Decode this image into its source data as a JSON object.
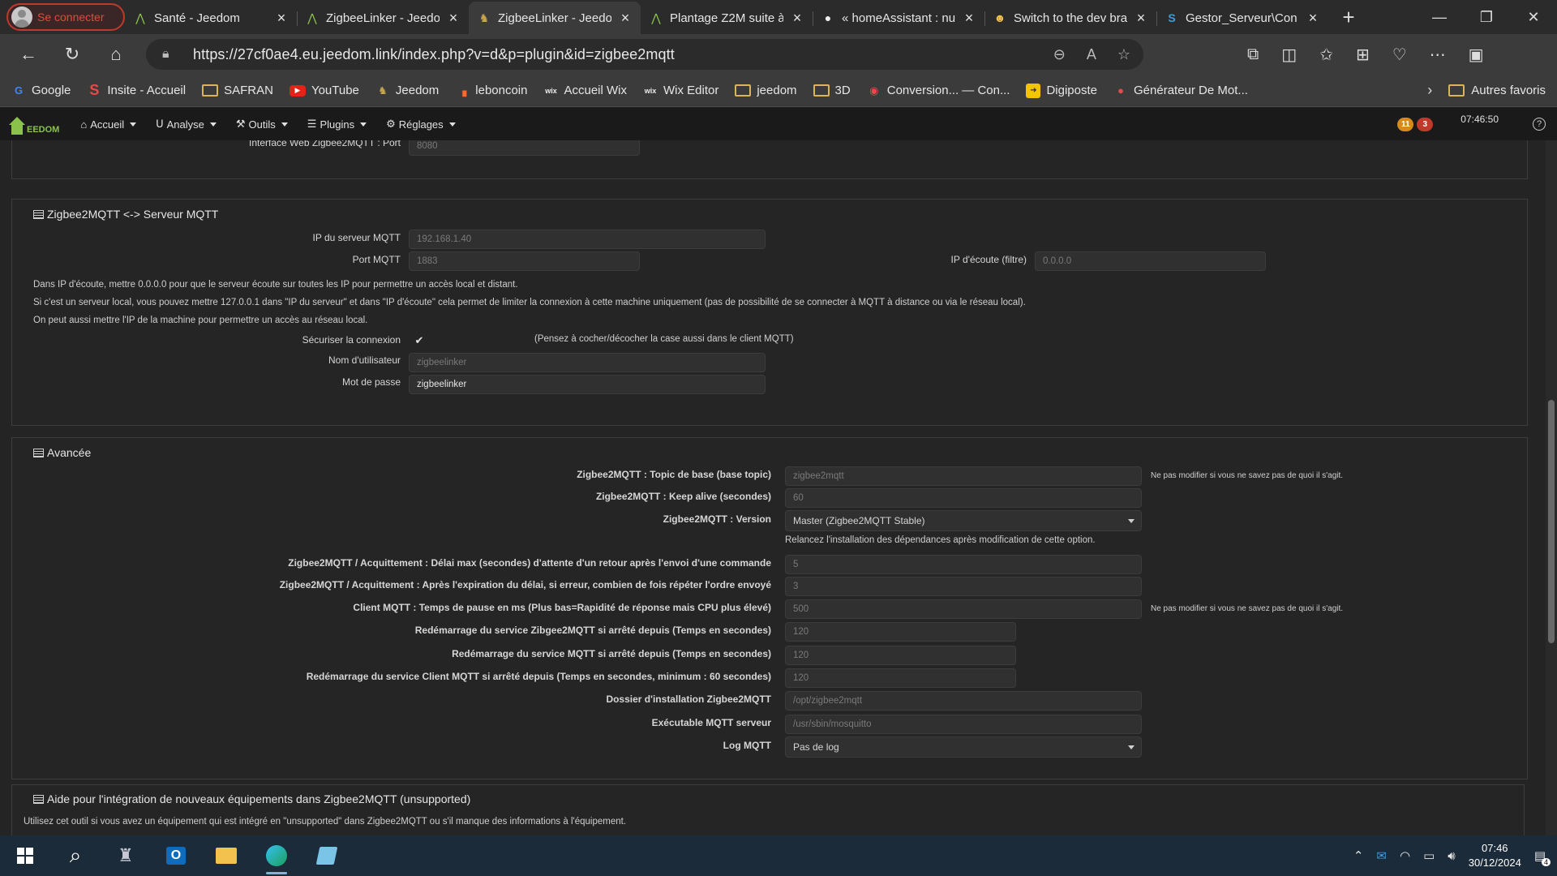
{
  "browser": {
    "profile_label": "Se connecter",
    "tabs": [
      {
        "title": "Santé - Jeedom",
        "active": false
      },
      {
        "title": "ZigbeeLinker - Jeedom",
        "active": false
      },
      {
        "title": "ZigbeeLinker - Jeedom",
        "active": true
      },
      {
        "title": "Plantage Z2M suite à",
        "active": false
      },
      {
        "title": "« homeAssistant : nu",
        "active": false
      },
      {
        "title": "Switch to the dev bra",
        "active": false
      },
      {
        "title": "Gestor_Serveur\\Con",
        "active": false
      }
    ],
    "url": "https://27cf0ae4.eu.jeedom.link/index.php?v=d&p=plugin&id=zigbee2mqtt",
    "bookmarks": [
      {
        "label": "Google",
        "icon": "google-icon"
      },
      {
        "label": "Insite - Accueil",
        "icon": "insite-icon"
      },
      {
        "label": "SAFRAN",
        "icon": "folder-icon"
      },
      {
        "label": "YouTube",
        "icon": "youtube-icon"
      },
      {
        "label": "Jeedom",
        "icon": "jeedom-icon"
      },
      {
        "label": "leboncoin",
        "icon": "leboncoin-icon"
      },
      {
        "label": "Accueil Wix",
        "icon": "wix-icon"
      },
      {
        "label": "Wix Editor",
        "icon": "wix-icon"
      },
      {
        "label": "jeedom",
        "icon": "folder-icon"
      },
      {
        "label": "3D",
        "icon": "folder-icon"
      },
      {
        "label": "Conversion... — Con...",
        "icon": "conversion-icon"
      },
      {
        "label": "Digiposte",
        "icon": "digiposte-icon"
      },
      {
        "label": "Générateur De Mot...",
        "icon": "lock-icon"
      }
    ],
    "other_bookmarks": "Autres favoris"
  },
  "jeedom": {
    "logo_text": "EEDOM",
    "menu": [
      {
        "label": "Accueil",
        "icon": "home-icon"
      },
      {
        "label": "Analyse",
        "icon": "analysis-icon"
      },
      {
        "label": "Outils",
        "icon": "wrench-icon"
      },
      {
        "label": "Plugins",
        "icon": "list-icon"
      },
      {
        "label": "Réglages",
        "icon": "gear-icon"
      }
    ],
    "badge_orange": "11",
    "badge_red": "3",
    "clock": "07:46:50",
    "help": "?"
  },
  "top_partial": {
    "label": "Interface Web Zigbee2MQTT : Port",
    "value": "8080"
  },
  "mqtt_section": {
    "title": "Zigbee2MQTT <-> Serveur MQTT",
    "ip_label": "IP du serveur MQTT",
    "ip_value": "192.168.1.40",
    "port_label": "Port MQTT",
    "port_value": "1883",
    "listen_label": "IP d'écoute (filtre)",
    "listen_value": "0.0.0.0",
    "note1": "Dans IP d'écoute, mettre 0.0.0.0 pour que le serveur écoute sur toutes les IP pour permettre un accès local et distant.",
    "note2": "Si c'est un serveur local, vous pouvez mettre 127.0.0.1 dans \"IP du serveur\" et dans \"IP d'écoute\" cela permet de limiter la connexion à cette machine uniquement (pas de possibilité de se connecter à MQTT à distance ou via le réseau local).",
    "note3": "On peut aussi mettre l'IP de la machine pour permettre un accès au réseau local.",
    "secure_label": "Sécuriser la connexion",
    "secure_hint": "(Pensez à cocher/décocher la case aussi dans le client MQTT)",
    "user_label": "Nom d'utilisateur",
    "user_value": "zigbeelinker",
    "pass_label": "Mot de passe",
    "pass_value": "zigbeelinker"
  },
  "advanced_section": {
    "title": "Avancée",
    "hint": "Ne pas modifier si vous ne savez pas de quoi il s'agit.",
    "topic_label": "Zigbee2MQTT : Topic de base (base topic)",
    "topic_value": "zigbee2mqtt",
    "keepalive_label": "Zigbee2MQTT : Keep alive (secondes)",
    "keepalive_value": "60",
    "version_label": "Zigbee2MQTT : Version",
    "version_value": "Master (Zigbee2MQTT Stable)",
    "version_note": "Relancez l'installation des dépendances après modification de cette option.",
    "ack_delay_label": "Zigbee2MQTT / Acquittement : Délai max (secondes) d'attente d'un retour après l'envoi d'une commande",
    "ack_delay_value": "5",
    "ack_repeat_label": "Zigbee2MQTT / Acquittement : Après l'expiration du délai, si erreur, combien de fois répéter l'ordre envoyé",
    "ack_repeat_value": "3",
    "pause_label": "Client MQTT : Temps de pause en ms (Plus bas=Rapidité de réponse mais CPU plus élevé)",
    "pause_value": "500",
    "restart_z2m_label": "Redémarrage du service Zibgee2MQTT si arrêté depuis (Temps en secondes)",
    "restart_z2m_value": "120",
    "restart_mqtt_label": "Redémarrage du service MQTT si arrêté depuis (Temps en secondes)",
    "restart_mqtt_value": "120",
    "restart_client_label": "Redémarrage du service Client MQTT si arrêté depuis (Temps en secondes, minimum : 60 secondes)",
    "restart_client_value": "120",
    "install_dir_label": "Dossier d'installation Zigbee2MQTT",
    "install_dir_value": "/opt/zigbee2mqtt",
    "exec_label": "Exécutable MQTT serveur",
    "exec_value": "/usr/sbin/mosquitto",
    "log_label": "Log MQTT",
    "log_value": "Pas de log"
  },
  "help_section": {
    "title": "Aide pour l'intégration de nouveaux équipements dans Zigbee2MQTT (unsupported)",
    "note": "Utilisez cet outil si vous avez un équipement qui est intégré en \"unsupported\" dans Zigbee2MQTT ou s'il manque des informations à l'équipement."
  },
  "taskbar": {
    "time": "07:46",
    "date": "30/12/2024",
    "notif_count": "4"
  }
}
